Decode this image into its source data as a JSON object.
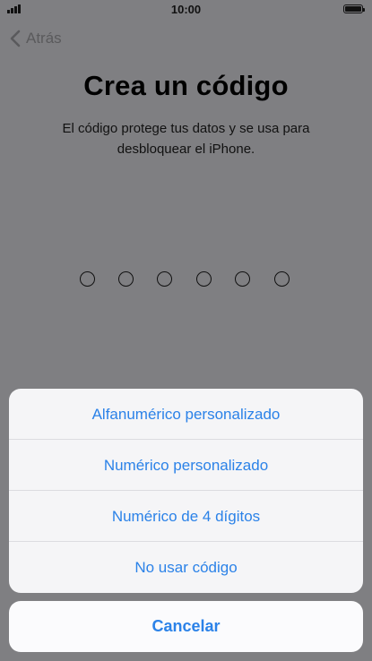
{
  "status_bar": {
    "time": "10:00"
  },
  "nav": {
    "back_label": "Atrás"
  },
  "passcode": {
    "title": "Crea un código",
    "description": "El código protege tus datos y se usa para desbloquear el iPhone.",
    "digits_total": 6,
    "digits_entered": 0
  },
  "action_sheet": {
    "options": [
      {
        "label": "Alfanumérico personalizado"
      },
      {
        "label": "Numérico personalizado"
      },
      {
        "label": "Numérico de 4 dígitos"
      },
      {
        "label": "No usar código"
      }
    ],
    "cancel_label": "Cancelar"
  },
  "colors": {
    "accent": "#2b82e8",
    "dimmed_background": "#7f7f82",
    "sheet_background": "#f5f5f7"
  }
}
